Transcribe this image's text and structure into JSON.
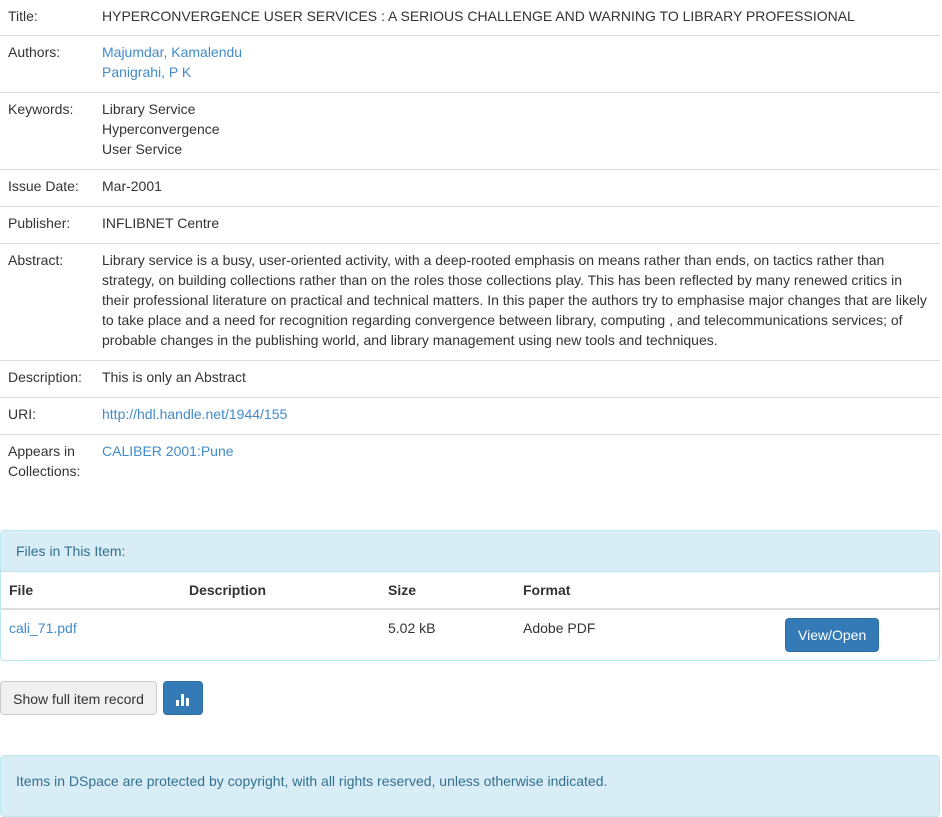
{
  "item": {
    "title_label": "Title:",
    "title": "HYPERCONVERGENCE USER SERVICES : A SERIOUS CHALLENGE AND WARNING TO LIBRARY PROFESSIONAL",
    "authors_label": "Authors:",
    "authors": [
      "Majumdar, Kamalendu",
      "Panigrahi, P K"
    ],
    "keywords_label": "Keywords:",
    "keywords": [
      "Library Service",
      "Hyperconvergence",
      "User Service"
    ],
    "issue_date_label": "Issue Date:",
    "issue_date": "Mar-2001",
    "publisher_label": "Publisher:",
    "publisher": "INFLIBNET Centre",
    "abstract_label": "Abstract:",
    "abstract": "Library service is a busy, user-oriented activity, with a deep-rooted emphasis on means rather than ends, on tactics rather than strategy, on building collections rather than on the roles those collections play. This has been reflected by many renewed critics in their professional literature on practical and technical matters. In this paper the authors try to emphasise major changes that are likely to take place and a need for recognition regarding convergence between library, computing , and telecommunications services; of probable changes in the publishing world, and library management using new tools and techniques.",
    "description_label": "Description:",
    "description": "This is only an Abstract",
    "uri_label": "URI:",
    "uri": "http://hdl.handle.net/1944/155",
    "collections_label_line1": "Appears in",
    "collections_label_line2": "Collections:",
    "collection": "CALIBER 2001:Pune"
  },
  "files": {
    "heading": "Files in This Item:",
    "columns": [
      "File",
      "Description",
      "Size",
      "Format"
    ],
    "rows": [
      {
        "file": "cali_71.pdf",
        "description": "",
        "size": "5.02 kB",
        "format": "Adobe PDF",
        "action": "View/Open"
      }
    ]
  },
  "actions": {
    "show_full_record": "Show full item record",
    "stats_icon": "bar-chart-icon"
  },
  "footer": {
    "copyright": "Items in DSpace are protected by copyright, with all rights reserved, unless otherwise indicated."
  },
  "colors": {
    "link": "#428bca",
    "primary_button": "#337ab7",
    "info_panel_bg": "#d9edf7",
    "info_panel_text": "#31708f"
  }
}
